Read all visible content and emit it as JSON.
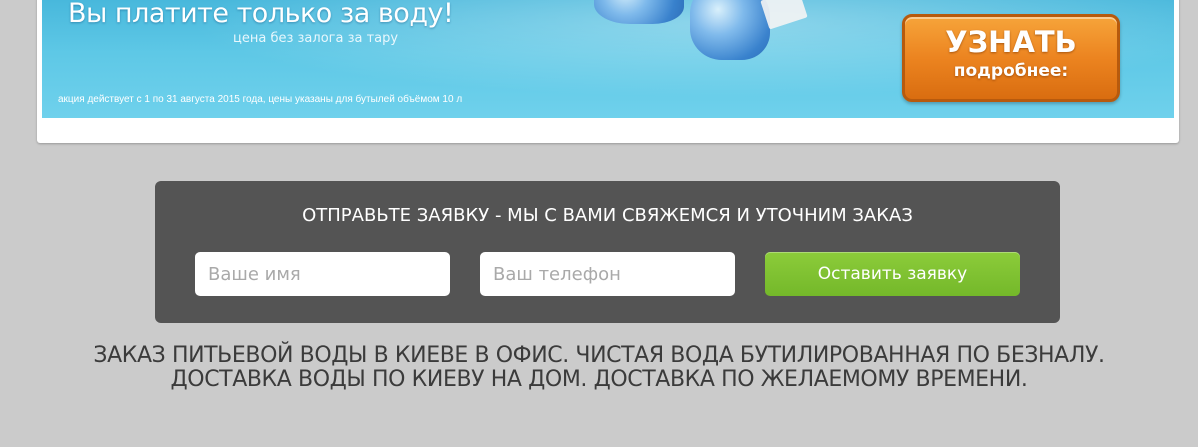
{
  "banner": {
    "title": "Вы платите только за воду!",
    "subtitle": "цена без залога за тару",
    "note": "акция действует с 1 по 31 августа 2015 года, цены указаны для бутылей объёмом 10 л",
    "cta_main": "УЗНАТЬ",
    "cta_sub": "подробнее:"
  },
  "order_form": {
    "heading": "ОТПРАВЬТЕ ЗАЯВКУ - МЫ С ВАМИ СВЯЖЕМСЯ И УТОЧНИМ ЗАКАЗ",
    "name_placeholder": "Ваше имя",
    "phone_placeholder": "Ваш телефон",
    "submit_label": "Оставить заявку"
  },
  "seo": {
    "line1": "ЗАКАЗ ПИТЬЕВОЙ ВОДЫ В КИЕВЕ В ОФИС. ЧИСТАЯ ВОДА БУТИЛИРОВАННАЯ ПО БЕЗНАЛУ.",
    "line2": "ДОСТАВКА ВОДЫ ПО КИЕВУ НА ДОМ. ДОСТАВКА ПО ЖЕЛАЕМОМУ ВРЕМЕНИ."
  },
  "colors": {
    "page_bg": "#cbcbcb",
    "banner_blue": "#5ec8e6",
    "cta_orange": "#ec8420",
    "panel_bg": "#545454",
    "submit_green": "#7fc231"
  }
}
